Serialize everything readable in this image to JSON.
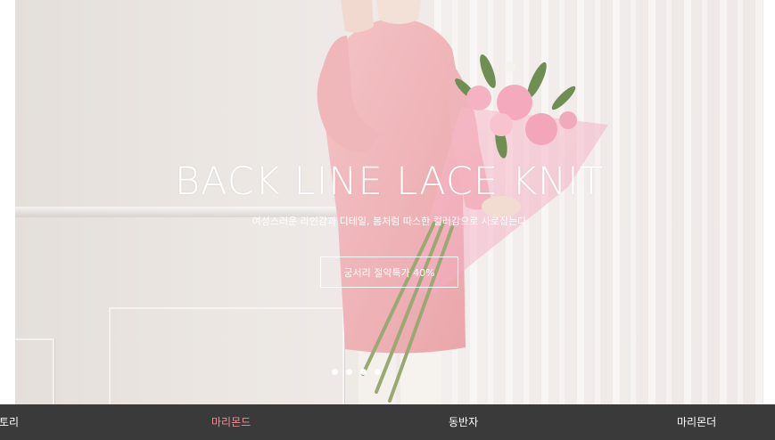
{
  "hero": {
    "title": "BACK LINE LACE KNIT",
    "subtitle": "여성스러운 라인감과 디테일, 봄처럼 따스한 컬러감으로 사로잡는다",
    "cta_label": "궁서리 절약특가 40%",
    "slides_count": 4
  },
  "bottom_nav": {
    "items": [
      {
        "label": "토리",
        "active": false
      },
      {
        "label": "마리몬드",
        "active": true
      },
      {
        "label": "동반자",
        "active": false
      },
      {
        "label": "마리몬더",
        "active": false
      }
    ]
  },
  "colors": {
    "nav_background": "#3a3a3a",
    "nav_active": "#f28f92",
    "sweater_pink": "#f2bcc0"
  }
}
